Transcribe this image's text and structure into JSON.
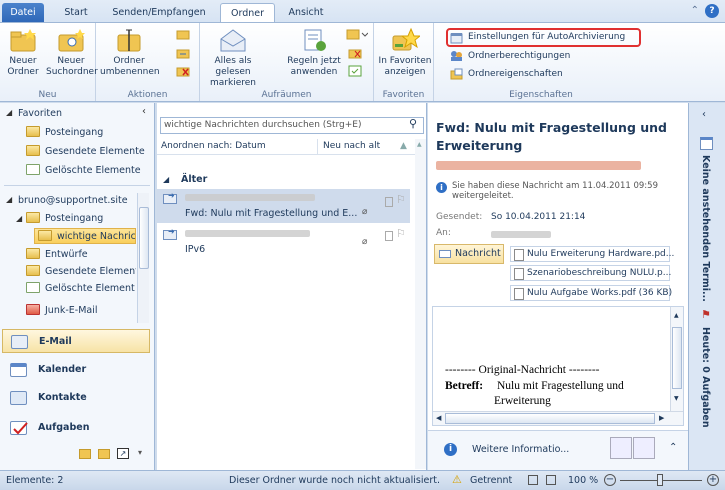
{
  "tabs": {
    "file": "Datei",
    "start": "Start",
    "send": "Senden/Empfangen",
    "folder": "Ordner",
    "view": "Ansicht"
  },
  "ribbon": {
    "new_group": "Neu",
    "new_folder": "Neuer Ordner",
    "new_search_folder": "Neuer Suchordner",
    "actions_group": "Aktionen",
    "rename_folder": "Ordner umbenennen",
    "cleanup_group": "Aufräumen",
    "mark_all_read": "Alles als gelesen markieren",
    "apply_rules": "Regeln jetzt anwenden",
    "favorites_group": "Favoriten",
    "show_in_favorites": "In Favoriten anzeigen",
    "properties_group": "Eigenschaften",
    "autoarchive_settings": "Einstellungen für AutoArchivierung",
    "folder_permissions": "Ordnerberechtigungen",
    "folder_properties": "Ordnereigenschaften",
    "highlight_color": "#e03030"
  },
  "nav": {
    "favorites": "Favoriten",
    "fav_inbox": "Posteingang",
    "fav_sent": "Gesendete Elemente",
    "fav_deleted": "Gelöschte Elemente",
    "account": "bruno@supportnet.site",
    "inbox": "Posteingang",
    "important": "wichtige Nachricht",
    "drafts": "Entwürfe",
    "sent": "Gesendete Element",
    "deleted": "Gelöschte Element",
    "junk": "Junk-E-Mail",
    "mail": "E-Mail",
    "calendar": "Kalender",
    "contacts": "Kontakte",
    "tasks": "Aufgaben"
  },
  "list": {
    "search_placeholder": "wichtige Nachrichten durchsuchen (Strg+E)",
    "arrange_by": "Anordnen nach: Datum",
    "sort_order": "Neu nach alt",
    "group_older": "Älter",
    "msg1_subject": "Fwd: Nulu mit Fragestellung und E...",
    "msg2_subject": "IPv6"
  },
  "reading": {
    "subject": "Fwd: Nulu mit Fragestellung und Erweiterung",
    "info": "Sie haben diese Nachricht am 11.04.2011 09:59 weitergeleitet.",
    "sent_label": "Gesendet:",
    "sent_value": "So 10.04.2011 21:14",
    "to_label": "An:",
    "message_tab": "Nachricht",
    "attachments": [
      "Nulu Erweiterung Hardware.pd...",
      "Szenariobeschreibung NULU.p...",
      "Nulu Aufgabe Works.pdf (36 KB)"
    ],
    "original_header": "-------- Original-Nachricht --------",
    "betreff_label": "Betreff:",
    "betreff_value": "Nulu mit Fragestellung und",
    "betreff_value2": "Erweiterung",
    "people_info": "Weitere Informatio..."
  },
  "todo": {
    "no_appointments": "Keine anstehenden Termi...",
    "today_tasks": "Heute: 0 Aufgaben"
  },
  "status": {
    "items": "Elemente: 2",
    "message": "Dieser Ordner wurde noch nicht aktualisiert.",
    "connection": "Getrennt",
    "zoom": "100 %"
  }
}
